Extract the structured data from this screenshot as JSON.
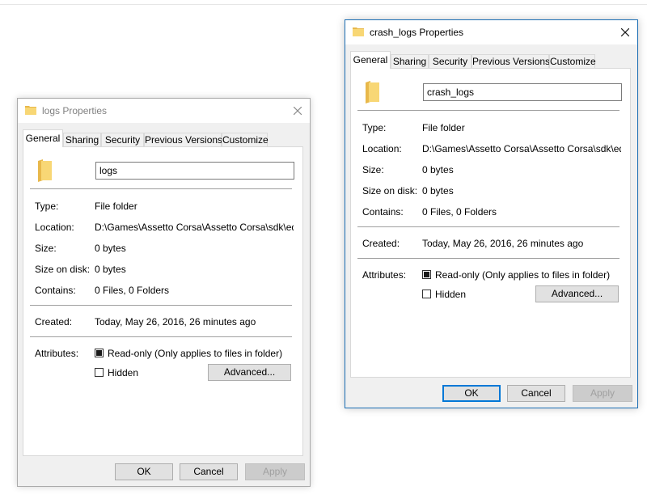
{
  "colors": {
    "accent": "#0078d7",
    "folder": "#f8d775",
    "folder_dark": "#e8b84b"
  },
  "dialog_logs": {
    "title": "logs Properties",
    "title_icon": "folder-icon",
    "tabs": [
      "General",
      "Sharing",
      "Security",
      "Previous Versions",
      "Customize"
    ],
    "name_value": "logs",
    "rows": [
      {
        "label": "Type:",
        "value": "File folder"
      },
      {
        "label": "Location:",
        "value": "D:\\Games\\Assetto Corsa\\Assetto Corsa\\sdk\\editor\\"
      },
      {
        "label": "Size:",
        "value": "0 bytes"
      },
      {
        "label": "Size on disk:",
        "value": "0 bytes"
      },
      {
        "label": "Contains:",
        "value": "0 Files, 0 Folders"
      }
    ],
    "created_label": "Created:",
    "created_value": "Today, May 26, 2016, 26 minutes ago",
    "attributes_label": "Attributes:",
    "readonly_label": "Read-only (Only applies to files in folder)",
    "readonly_state": "indeterminate",
    "hidden_label": "Hidden",
    "hidden_checked": false,
    "advanced_label": "Advanced...",
    "ok_label": "OK",
    "cancel_label": "Cancel",
    "apply_label": "Apply"
  },
  "dialog_crash_logs": {
    "title": "crash_logs Properties",
    "title_icon": "folder-icon",
    "tabs": [
      "General",
      "Sharing",
      "Security",
      "Previous Versions",
      "Customize"
    ],
    "name_value": "crash_logs",
    "rows": [
      {
        "label": "Type:",
        "value": "File folder"
      },
      {
        "label": "Location:",
        "value": "D:\\Games\\Assetto Corsa\\Assetto Corsa\\sdk\\editor"
      },
      {
        "label": "Size:",
        "value": "0 bytes"
      },
      {
        "label": "Size on disk:",
        "value": "0 bytes"
      },
      {
        "label": "Contains:",
        "value": "0 Files, 0 Folders"
      }
    ],
    "created_label": "Created:",
    "created_value": "Today, May 26, 2016, 26 minutes ago",
    "attributes_label": "Attributes:",
    "readonly_label": "Read-only (Only applies to files in folder)",
    "readonly_state": "indeterminate",
    "hidden_label": "Hidden",
    "hidden_checked": false,
    "advanced_label": "Advanced...",
    "ok_label": "OK",
    "cancel_label": "Cancel",
    "apply_label": "Apply"
  }
}
